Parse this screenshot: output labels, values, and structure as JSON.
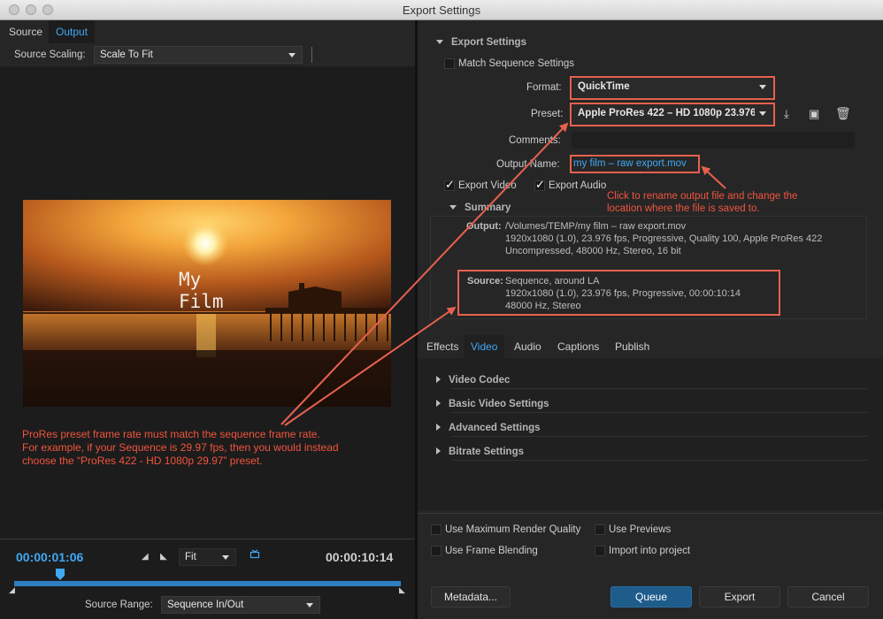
{
  "window": {
    "title": "Export Settings"
  },
  "left": {
    "tabs": [
      "Source",
      "Output"
    ],
    "source_scaling_label": "Source Scaling:",
    "source_scaling_value": "Scale To Fit",
    "preview_text_line1": "My",
    "preview_text_line2": "Film",
    "annotation": [
      "ProRes preset frame rate must match the sequence frame rate.",
      "For example, if your Sequence is 29.97 fps, then you would instead",
      "choose the “ProRes 422 -  HD 1080p 29.97” preset."
    ],
    "timecode_current": "00:00:01:06",
    "timecode_end": "00:00:10:14",
    "zoom_value": "Fit",
    "source_range_label": "Source Range:",
    "source_range_value": "Sequence In/Out",
    "playhead_fraction": 0.12
  },
  "export": {
    "section_title": "Export Settings",
    "match_sequence_label": "Match Sequence Settings",
    "format_label": "Format:",
    "format_value": "QuickTime",
    "preset_label": "Preset:",
    "preset_value": "Apple ProRes 422 – HD 1080p 23.976",
    "comments_label": "Comments:",
    "comments_value": "",
    "output_name_label": "Output Name:",
    "output_name_value": "my film – raw export.mov",
    "export_video_label": "Export Video",
    "export_audio_label": "Export Audio",
    "annotation": [
      "Click to rename output file and change the",
      "location where the file is saved to."
    ],
    "summary_title": "Summary",
    "output_label": "Output:",
    "output_lines": [
      "/Volumes/TEMP/my film – raw export.mov",
      "1920x1080 (1.0), 23.976 fps, Progressive, Quality 100, Apple ProRes 422",
      "Uncompressed, 48000 Hz, Stereo, 16 bit"
    ],
    "source_label": "Source:",
    "source_lines": [
      "Sequence, around LA",
      "1920x1080 (1.0), 23.976 fps, Progressive, 00:00:10:14",
      "48000 Hz, Stereo"
    ]
  },
  "settings_tabs": [
    "Effects",
    "Video",
    "Audio",
    "Captions",
    "Publish"
  ],
  "video_sections": [
    "Video Codec",
    "Basic Video Settings",
    "Advanced Settings",
    "Bitrate Settings"
  ],
  "options": {
    "max_render_quality": "Use Maximum Render Quality",
    "use_previews": "Use Previews",
    "frame_blending": "Use Frame Blending",
    "import_into_project": "Import into project"
  },
  "buttons": {
    "metadata": "Metadata...",
    "queue": "Queue",
    "export": "Export",
    "cancel": "Cancel"
  },
  "colors": {
    "accent": "#3fa9f5",
    "annotation": "#e8614f",
    "queue": "#1e5c8c"
  }
}
